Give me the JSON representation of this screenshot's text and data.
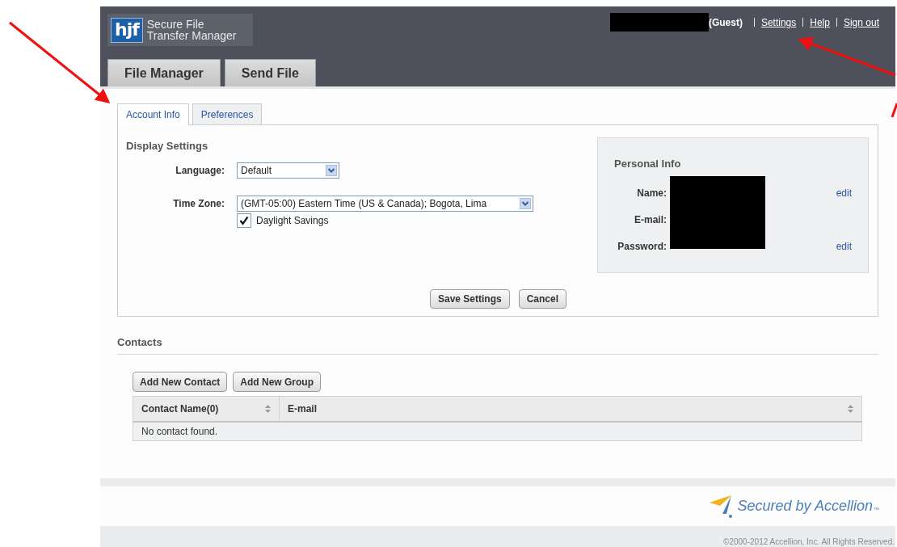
{
  "header": {
    "logo_mark": "hjf",
    "logo_title": [
      "Secure File",
      "Transfer Manager"
    ],
    "user_role": "(Guest)",
    "links": [
      {
        "label": "Settings"
      },
      {
        "label": "Help"
      },
      {
        "label": "Sign out"
      }
    ]
  },
  "main_tabs": [
    {
      "label": "File Manager",
      "selected": false
    },
    {
      "label": "Send File",
      "selected": false
    }
  ],
  "sub_tabs": [
    {
      "label": "Account Info",
      "selected": true
    },
    {
      "label": "Preferences",
      "selected": false
    }
  ],
  "display_settings": {
    "title": "Display Settings",
    "fields": [
      {
        "label": "Language:",
        "value": "Default"
      },
      {
        "label": "Time Zone:",
        "value": "(GMT-05:00) Eastern Time (US & Canada); Bogota, Lima"
      }
    ],
    "checkbox": {
      "label": "Daylight Savings",
      "checked": true
    }
  },
  "personal_info": {
    "title": "Personal Info",
    "rows": [
      {
        "label": "Name:",
        "action": "edit"
      },
      {
        "label": "E-mail:"
      },
      {
        "label": "Password:",
        "action": "edit"
      }
    ]
  },
  "buttons": [
    "Save Settings",
    "Cancel"
  ],
  "contacts": {
    "title": "Contacts",
    "buttons": [
      "Add New Contact",
      "Add New Group"
    ],
    "columns": [
      "Contact Name(0)",
      "E-mail"
    ],
    "empty_message": "No contact found."
  },
  "footer": {
    "brand": "Secured by Accellion",
    "trademark": "™",
    "copyright": "©2000-2012 Accellion, Inc. All Rights Reserved."
  }
}
